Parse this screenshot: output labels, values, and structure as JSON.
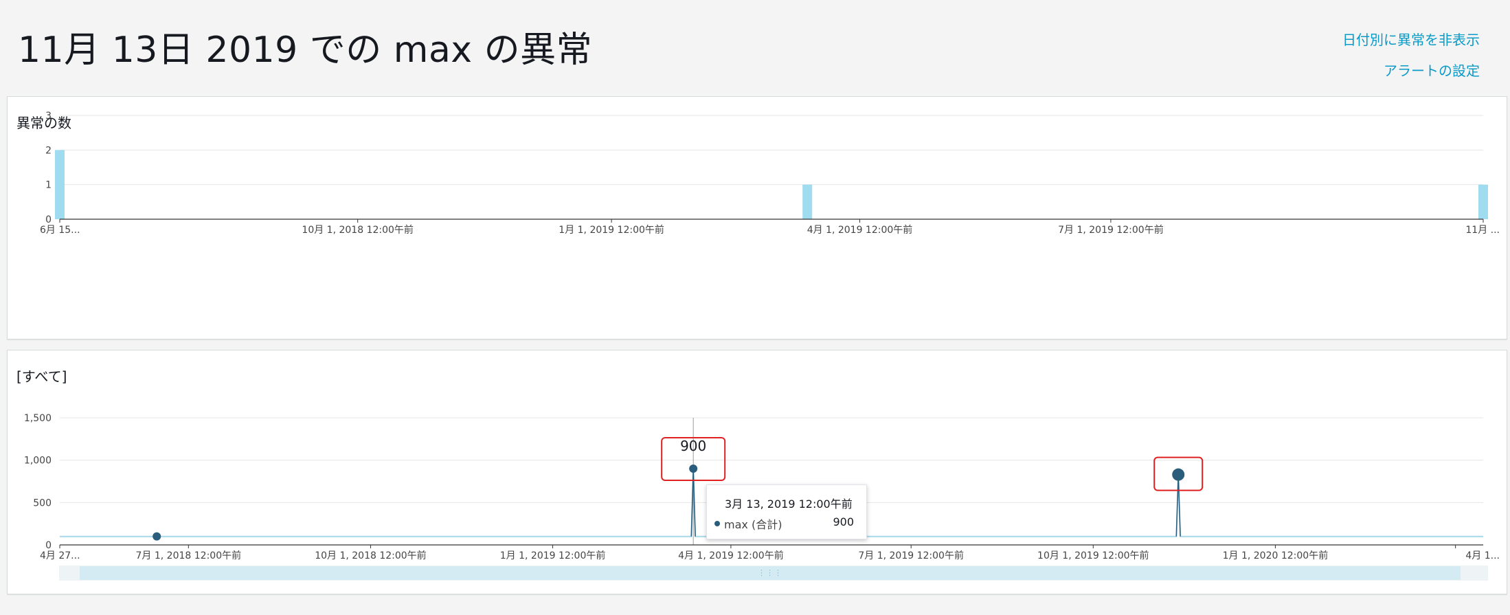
{
  "header": {
    "title": "11月 13日 2019 での max の異常",
    "links": [
      "日付別に異常を非表示",
      "アラートの設定"
    ]
  },
  "chart_data": [
    {
      "type": "bar",
      "title": "異常の数",
      "ylim": [
        0,
        3
      ],
      "yticks": [
        "0",
        "1",
        "2",
        "3"
      ],
      "xticks": [
        "6月 15...",
        "10月 1, 2018 12:00午前",
        "1月 1, 2019 12:00午前",
        "4月 1, 2019 12:00午前",
        "7月 1, 2019 12:00午前",
        "11月 ..."
      ],
      "x": [
        "2018-06-15",
        "2019-03-13",
        "2019-11-13"
      ],
      "values": [
        2,
        1,
        1
      ],
      "color": "#9fdcf0",
      "grid": true
    },
    {
      "type": "line",
      "title": "[すべて]",
      "ylim": [
        0,
        1500
      ],
      "yticks": [
        "0",
        "500",
        "1,000",
        "1,500"
      ],
      "xticks": [
        "4月 27...",
        "7月 1, 2018 12:00午前",
        "10月 1, 2018 12:00午前",
        "1月 1, 2019 12:00午前",
        "4月 1, 2019 12:00午前",
        "7月 1, 2019 12:00午前",
        "10月 1, 2019 12:00午前",
        "1月 1, 2020 12:00午前",
        "4月 1..."
      ],
      "series": [
        {
          "name": "max (合計)",
          "color": "#2a5d7c",
          "x": [
            "2018-04-27",
            "2018-06-15",
            "2019-03-12",
            "2019-03-13",
            "2019-03-14",
            "2019-11-12",
            "2019-11-13",
            "2019-11-14",
            "2020-04-15"
          ],
          "values": [
            100,
            100,
            100,
            900,
            100,
            100,
            830,
            100,
            100
          ]
        }
      ],
      "anomalies": [
        {
          "x": "2018-06-15",
          "value": 100
        },
        {
          "x": "2019-03-13",
          "value": 900
        },
        {
          "x": "2019-11-13",
          "value": 830
        }
      ],
      "value_label": "900",
      "tooltip": {
        "date": "3月 13, 2019 12:00午前",
        "series": "max (合計)",
        "value": "900"
      },
      "grid": true
    }
  ]
}
